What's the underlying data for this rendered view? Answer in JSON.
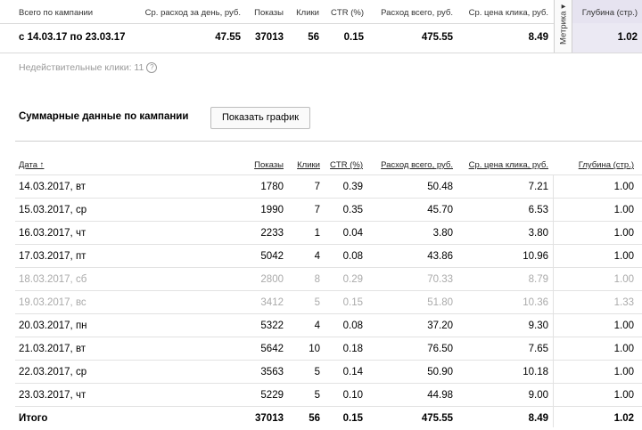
{
  "summary": {
    "headers": [
      "Всего по кампании",
      "Ср. расход за день, руб.",
      "Показы",
      "Клики",
      "CTR (%)",
      "Расход всего, руб.",
      "Ср. цена клика, руб.",
      "Глубина (стр.)"
    ],
    "metrika_label": "Метрика ▾",
    "period": "с 14.03.17 по 23.03.17",
    "avg_daily": "47.55",
    "impressions": "37013",
    "clicks": "56",
    "ctr": "0.15",
    "total_spend": "475.55",
    "avg_cpc": "8.49",
    "depth": "1.02"
  },
  "invalid_clicks": "Недействительные клики: 11",
  "section_title": "Суммарные данные по кампании",
  "show_chart_button": "Показать график",
  "table": {
    "headers": [
      "Дата ↑",
      "Показы",
      "Клики",
      "CTR (%)",
      "Расход всего, руб.",
      "Ср. цена клика, руб.",
      "Глубина (стр.)"
    ],
    "rows": [
      [
        "14.03.2017, вт",
        "1780",
        "7",
        "0.39",
        "50.48",
        "7.21",
        "1.00"
      ],
      [
        "15.03.2017, ср",
        "1990",
        "7",
        "0.35",
        "45.70",
        "6.53",
        "1.00"
      ],
      [
        "16.03.2017, чт",
        "2233",
        "1",
        "0.04",
        "3.80",
        "3.80",
        "1.00"
      ],
      [
        "17.03.2017, пт",
        "5042",
        "4",
        "0.08",
        "43.86",
        "10.96",
        "1.00"
      ],
      [
        "18.03.2017, сб",
        "2800",
        "8",
        "0.29",
        "70.33",
        "8.79",
        "1.00"
      ],
      [
        "19.03.2017, вс",
        "3412",
        "5",
        "0.15",
        "51.80",
        "10.36",
        "1.33"
      ],
      [
        "20.03.2017, пн",
        "5322",
        "4",
        "0.08",
        "37.20",
        "9.30",
        "1.00"
      ],
      [
        "21.03.2017, вт",
        "5642",
        "10",
        "0.18",
        "76.50",
        "7.65",
        "1.00"
      ],
      [
        "22.03.2017, ср",
        "3563",
        "5",
        "0.14",
        "50.90",
        "10.18",
        "1.00"
      ],
      [
        "23.03.2017, чт",
        "5229",
        "5",
        "0.10",
        "44.98",
        "9.00",
        "1.00"
      ]
    ],
    "total": [
      "Итого",
      "37013",
      "56",
      "0.15",
      "475.55",
      "8.49",
      "1.02"
    ]
  }
}
